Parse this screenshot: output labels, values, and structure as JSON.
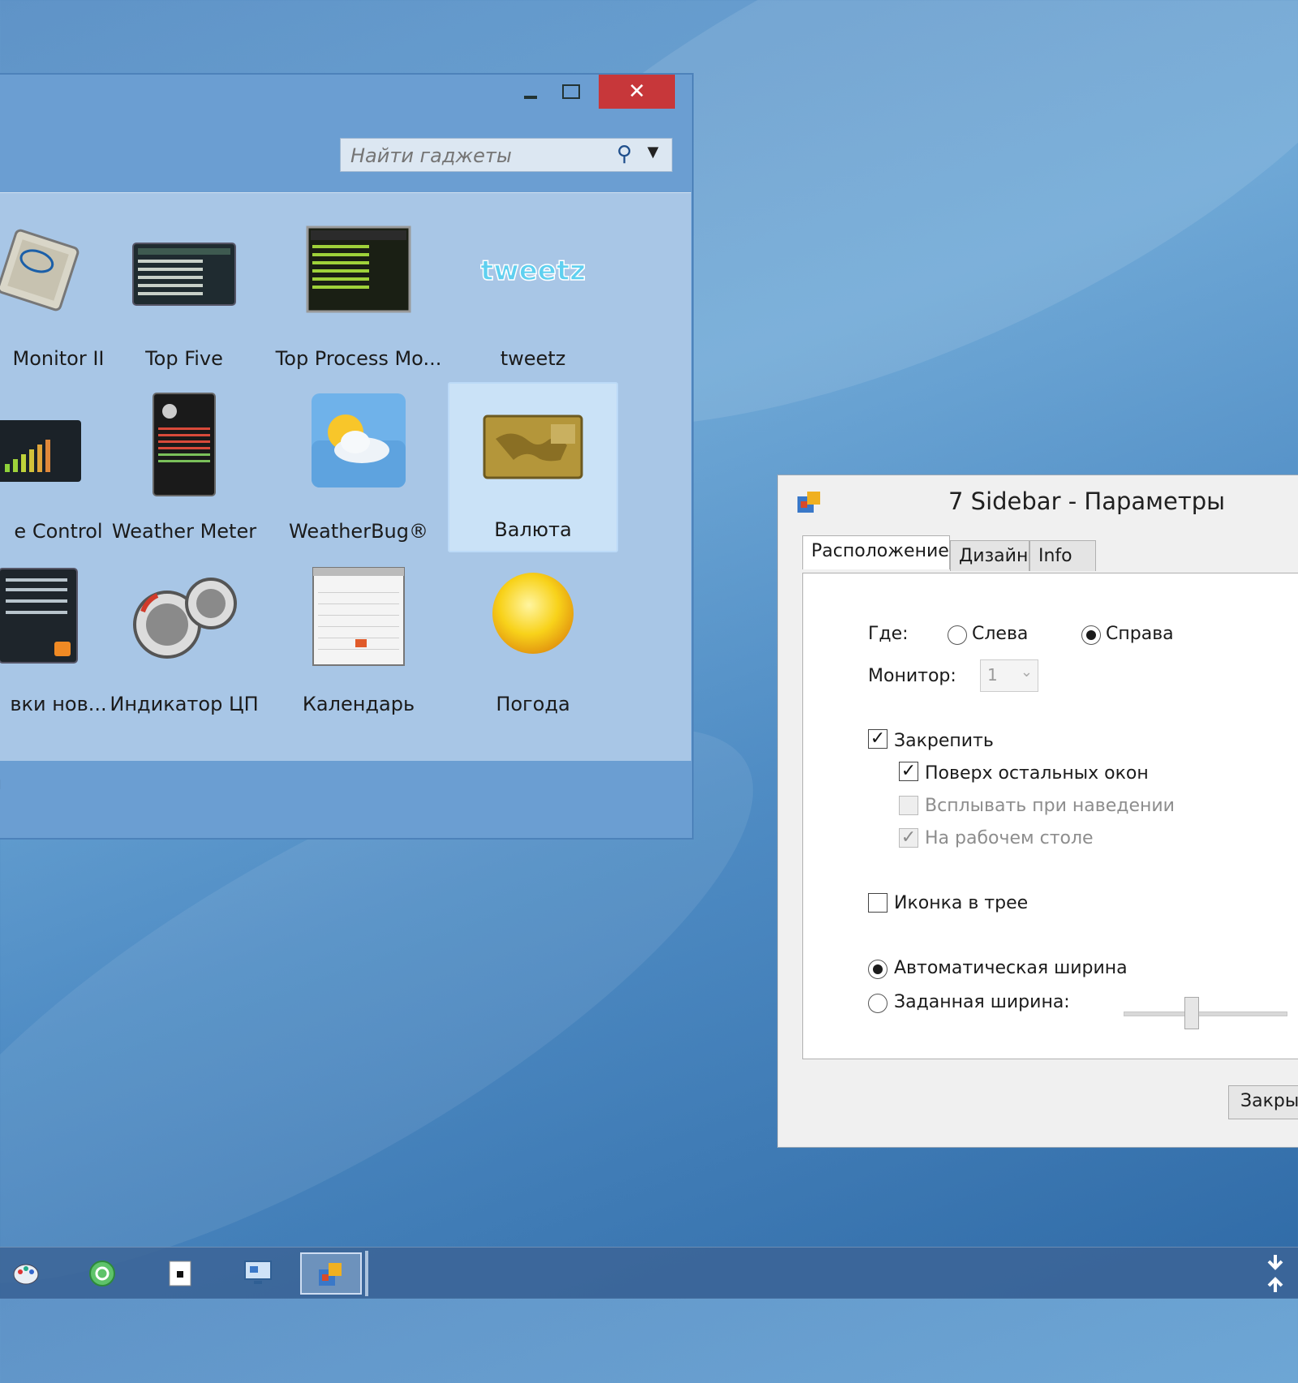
{
  "gallery": {
    "search": {
      "placeholder": "Найти гаджеты"
    },
    "gadgets": [
      {
        "label": "Monitor II",
        "icon": "cpu-chip-icon"
      },
      {
        "label": "Top Five",
        "icon": "top-five-panel-icon"
      },
      {
        "label": "Top Process Mo...",
        "icon": "top-process-monitor-icon"
      },
      {
        "label": "tweetz",
        "icon": "tweetz-logo-icon"
      },
      {
        "label": "e Control",
        "icon": "volume-bars-icon"
      },
      {
        "label": "Weather Meter",
        "icon": "weather-meter-icon"
      },
      {
        "label": "WeatherBug®",
        "icon": "weather-cloud-sun-icon"
      },
      {
        "label": "Валюта",
        "icon": "currency-card-icon"
      },
      {
        "label": "вки нов...",
        "icon": "news-feed-icon"
      },
      {
        "label": "Индикатор ЦП",
        "icon": "cpu-gauge-icon"
      },
      {
        "label": "Календарь",
        "icon": "calendar-icon"
      },
      {
        "label": "Погода",
        "icon": "sun-icon"
      }
    ],
    "selected_index": 7,
    "footer_text": "ı"
  },
  "settings": {
    "title": "7 Sidebar - Параметры",
    "tabs": [
      {
        "label": "Расположение",
        "active": true
      },
      {
        "label": "Дизайн",
        "active": false
      },
      {
        "label": "Info",
        "active": false
      }
    ],
    "where_label": "Где:",
    "where_left": "Слева",
    "where_right": "Справа",
    "where_selected": "Справа",
    "monitor_label": "Монитор:",
    "monitor_value": "1",
    "pin_label": "Закрепить",
    "pin_checked": true,
    "ontop_label": "Поверх остальных окон",
    "ontop_checked": true,
    "popup_label": "Всплывать при наведении",
    "popup_checked": false,
    "desktop_label": "На рабочем столе",
    "desktop_checked": true,
    "tray_label": "Иконка в трее",
    "tray_checked": false,
    "auto_width_label": "Автоматическая ширина",
    "fixed_width_label": "Заданная ширина:",
    "width_mode": "auto",
    "slider_fraction": 0.4,
    "close_label": "Закры"
  },
  "colors": {
    "close_button": "#c7373a",
    "selection": "#d6ebfc"
  }
}
